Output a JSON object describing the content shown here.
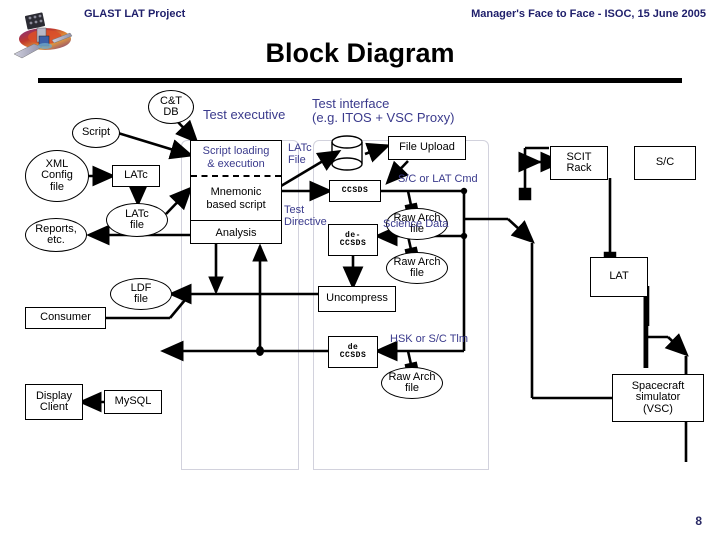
{
  "header": {
    "project": "GLAST LAT Project",
    "meeting": "Manager's Face to Face - ISOC, 15 June 2005",
    "title": "Block Diagram",
    "page_number": "8",
    "logo_name": "glast-spacecraft-logo",
    "text_color": "#1f1f6b",
    "rule_color": "#000000"
  },
  "regions": [
    {
      "label": "Test executive",
      "label2": ""
    },
    {
      "label": "Test interface",
      "label2": "(e.g. ITOS + VSC Proxy)"
    }
  ],
  "nodes": {
    "ct_db": "C&T\nDB",
    "script": "Script",
    "xml_config": "XML\nConfig\nfile",
    "latc": "LATc",
    "latc_file": "LATc\nfile",
    "reports": "Reports,\netc.",
    "script_loading": "Script loading\n& execution",
    "mnemonic": "Mnemonic\nbased script",
    "analysis": "Analysis",
    "file_upload": "File Upload",
    "ccsds_up": "CCSDS",
    "raw_arch_1": "Raw Arch\nfile",
    "de_ccsds_sci": "de-\nCCSDS",
    "raw_arch_2": "Raw Arch\nfile",
    "uncompress": "Uncompress",
    "de_ccsds_hsk": "de\nCCSDS",
    "raw_arch_3": "Raw Arch\nfile",
    "ldf_file": "LDF\nfile",
    "consumer": "Consumer",
    "display_client": "Display\nClient",
    "mysql": "MySQL",
    "scit_rack": "SCIT\nRack",
    "sc": "S/C",
    "lat": "LAT",
    "spacecraft_sim": "Spacecraft\nsimulator\n(VSC)",
    "database_cylinder": "database-cylinder"
  },
  "edge_labels": {
    "latc_file_flow": "LATc\nFile",
    "test_directive": "Test\nDirective",
    "sc_or_lat_cmd": "S/C or LAT Cmd",
    "science_data": "Science Data",
    "hsk_or_sc_tlm": "HSK or S/C Tlm"
  },
  "colors": {
    "label_blue": "#3a3a8c",
    "header_blue": "#1f1f6b",
    "region_border": "#d2d2dd",
    "line": "#000000"
  }
}
